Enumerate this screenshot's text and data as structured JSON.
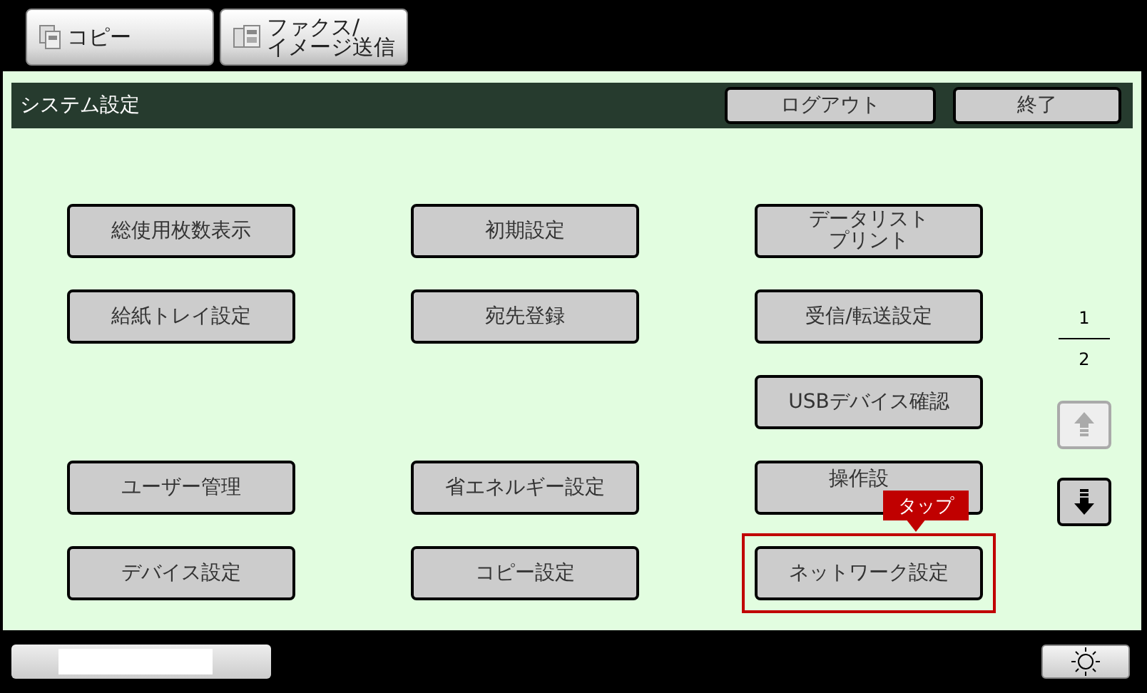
{
  "mode_tabs": [
    {
      "label": "コピー"
    },
    {
      "label": "ファクス/\nイメージ送信"
    }
  ],
  "header": {
    "title": "システム設定",
    "buttons": [
      "ログアウト",
      "終了"
    ]
  },
  "menu_rows": [
    {
      "cells": [
        {
          "lines": [
            "総使用枚数表示"
          ],
          "highlighted": false,
          "covered": false
        },
        {
          "lines": [
            "初期設定"
          ],
          "highlighted": false,
          "covered": false
        },
        {
          "lines": [
            "データリスト",
            "プリント"
          ],
          "highlighted": false,
          "covered": false
        }
      ]
    },
    {
      "cells": [
        {
          "lines": [
            "給紙トレイ設定"
          ],
          "highlighted": false,
          "covered": false
        },
        {
          "lines": [
            "宛先登録"
          ],
          "highlighted": false,
          "covered": false
        },
        {
          "lines": [
            "受信/転送設定"
          ],
          "highlighted": false,
          "covered": false
        }
      ]
    },
    {
      "cells": [
        null,
        null,
        {
          "lines": [
            "USBデバイス確認"
          ],
          "highlighted": false,
          "covered": false
        }
      ]
    },
    {
      "cells": [
        {
          "lines": [
            "ユーザー管理"
          ],
          "highlighted": false,
          "covered": false
        },
        {
          "lines": [
            "省エネルギー設定"
          ],
          "highlighted": false,
          "covered": false
        },
        {
          "lines": [
            "操作設"
          ],
          "highlighted": false,
          "covered": true
        }
      ]
    },
    {
      "cells": [
        {
          "lines": [
            "デバイス設定"
          ],
          "highlighted": false,
          "covered": false
        },
        {
          "lines": [
            "コピー設定"
          ],
          "highlighted": false,
          "covered": false
        },
        {
          "lines": [
            "ネットワーク設定"
          ],
          "highlighted": true,
          "covered": false
        }
      ]
    }
  ],
  "callout": "タップ",
  "pager": {
    "current": "1",
    "total": "2",
    "up_disabled": true,
    "down_disabled": false
  }
}
